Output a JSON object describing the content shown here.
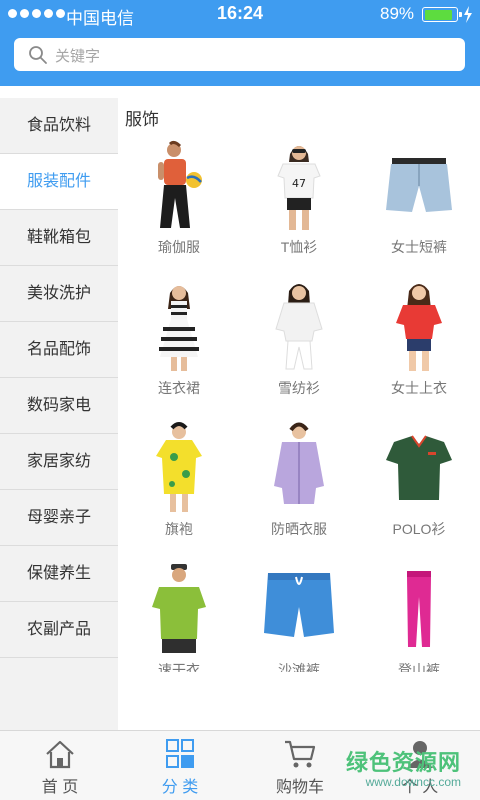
{
  "status_bar": {
    "carrier": "中国电信",
    "time": "16:24",
    "battery_percent": "89%",
    "battery_level": 0.89
  },
  "search": {
    "placeholder": "关键字"
  },
  "sidebar": {
    "items": [
      {
        "label": "食品饮料",
        "active": false
      },
      {
        "label": "服装配件",
        "active": true
      },
      {
        "label": "鞋靴箱包",
        "active": false
      },
      {
        "label": "美妆洗护",
        "active": false
      },
      {
        "label": "名品配饰",
        "active": false
      },
      {
        "label": "数码家电",
        "active": false
      },
      {
        "label": "家居家纺",
        "active": false
      },
      {
        "label": "母婴亲子",
        "active": false
      },
      {
        "label": "保健养生",
        "active": false
      },
      {
        "label": "农副产品",
        "active": false
      }
    ]
  },
  "section": {
    "title": "服饰"
  },
  "products": [
    {
      "label": "瑜伽服",
      "icon": "yoga-outfit-photo"
    },
    {
      "label": "T恤衫",
      "icon": "tshirt-photo"
    },
    {
      "label": "女士短裤",
      "icon": "denim-shorts-photo"
    },
    {
      "label": "连衣裙",
      "icon": "dress-photo"
    },
    {
      "label": "雪纺衫",
      "icon": "chiffon-shirt-photo"
    },
    {
      "label": "女士上衣",
      "icon": "womens-top-photo"
    },
    {
      "label": "旗袍",
      "icon": "cheongsam-photo"
    },
    {
      "label": "防晒衣服",
      "icon": "sun-protection-jacket-photo"
    },
    {
      "label": "POLO衫",
      "icon": "polo-shirt-photo"
    },
    {
      "label": "速干衣",
      "icon": "quick-dry-shirt-photo"
    },
    {
      "label": "沙滩裤",
      "icon": "beach-shorts-photo"
    },
    {
      "label": "登山裤",
      "icon": "hiking-pants-photo"
    }
  ],
  "tabbar": {
    "tabs": [
      {
        "label": "首 页",
        "icon": "home-icon",
        "active": false
      },
      {
        "label": "分 类",
        "icon": "category-grid-icon",
        "active": true
      },
      {
        "label": "购物车",
        "icon": "cart-icon",
        "active": false
      },
      {
        "label": "个 人",
        "icon": "person-icon",
        "active": false
      }
    ]
  },
  "watermark": {
    "text": "绿色资源网",
    "url": "www.downcc.com"
  },
  "colors": {
    "accent": "#3f9cf0",
    "battery": "#5ddc3f",
    "sidebar_bg": "#f2f2f2"
  }
}
